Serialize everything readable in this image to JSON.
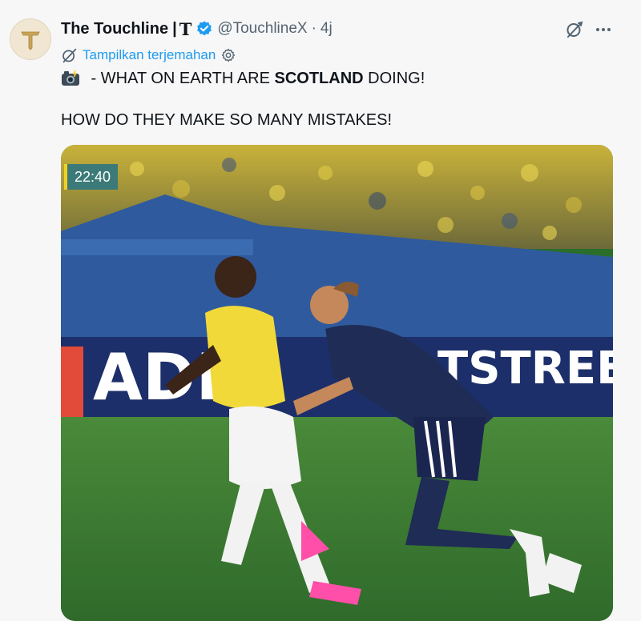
{
  "author": {
    "display_name": "The Touchline",
    "separator": "|",
    "badge_glyph": "T",
    "avatar_letter": "T",
    "handle": "@TouchlineX",
    "time_separator": "·",
    "time": "4j",
    "verified_color": "#1d9bf0"
  },
  "translate": {
    "label": "Tampilkan terjemahan",
    "icon": "grok-icon",
    "settings_icon": "gear-icon"
  },
  "text": {
    "line1_emoji": "camera-flash-icon",
    "line1_before": " - WHAT ON EARTH ARE ",
    "line1_bold": "SCOTLAND",
    "line1_after": " DOING!",
    "line2": "HOW DO THEY MAKE SO MANY MISTAKES!"
  },
  "media": {
    "timer": "22:40",
    "board_text_left": "ADI",
    "board_text_right": "TSTREE",
    "accent_timer_bar": "#f1d024"
  },
  "actions": {
    "grok_icon": "grok-icon",
    "more_icon": "more-icon"
  },
  "colors": {
    "accent": "#1d9bf0",
    "muted_text": "#536471",
    "background": "#f7f7f8"
  }
}
